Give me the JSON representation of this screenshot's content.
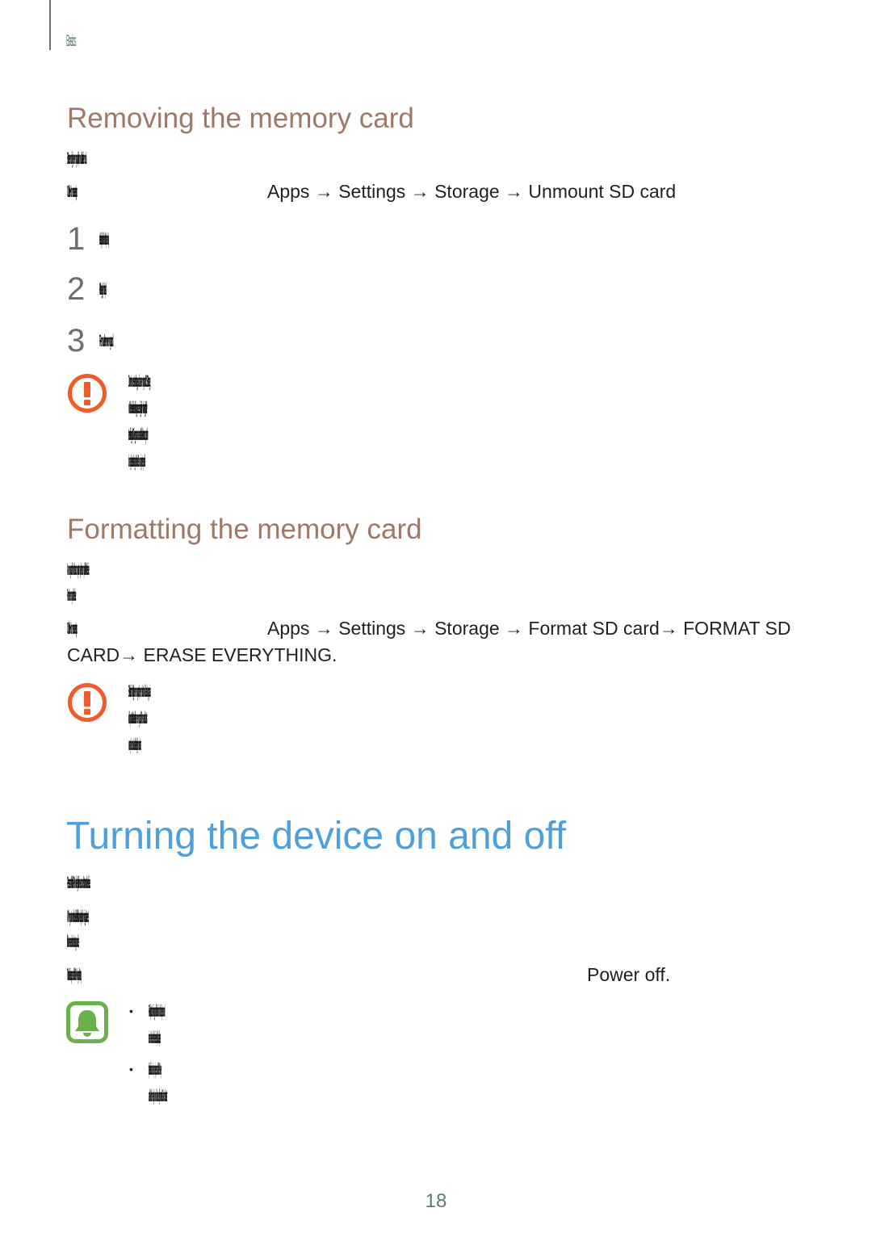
{
  "header": {
    "section_label": "Basics"
  },
  "removing": {
    "title": "Removing the memory card",
    "intro": "Before removing the memory card, first unmount it for safe removal.",
    "path_prefix": "On the Home screen, tap",
    "path": "Apps → Settings → Storage → Unmount SD card",
    "steps": [
      {
        "num": "1",
        "text": "Insert the ejection pin into the hole on the tray to loosen the tray."
      },
      {
        "num": "2",
        "text": "Pull out the tray gently from the tray slot."
      },
      {
        "num": "3",
        "text": "Remove the memory card."
      }
    ],
    "caution_lines": [
      "Do not remove external storage, such as a memory card or USB storage,",
      "while the device is transferring or accessing information, or right after",
      "transferring data. Doing so can cause data to be lost or corrupted or",
      "damage the external storage or the device. Samsung is not responsible"
    ]
  },
  "formatting": {
    "title": "Formatting the memory card",
    "intro_lines": [
      "A memory card formatted on a computer may not be compatible with the device.",
      "Format the memory card on the device."
    ],
    "path_prefix": "On the Home screen, tap",
    "path_line1": "Apps → Settings → Storage → Format SD card→ FORMAT SD",
    "path_line2": "CARD→ ERASE EVERYTHING.",
    "caution_lines": [
      "Before formatting the memory card, remember to make backup copies",
      "of all important data stored in the memory card. The manufacturer's",
      "warranty does not cover loss of data resulting from user actions."
    ]
  },
  "turning": {
    "title": "Turning the device on and off",
    "para1": "Press and hold the Power key for a few seconds to turn on the device.",
    "para2_lines": [
      "When you turn on the device for the first time or after performing a data reset,",
      "follow the on-screen instructions to set up your device."
    ],
    "para3_prefix": "To turn off the device, press and hold the Power key, and then tap",
    "para3_action": "Power off.",
    "notes": [
      {
        "bullet": "•",
        "lines": [
          "Follow all posted warnings and directions from authorized personnel",
          "in areas where the use of wireless devices is restricted, such as airplanes"
        ]
      },
      {
        "bullet": "•",
        "lines": [
          "If your device is frozen and unresponsive, press and hold the Power key",
          "and the Volume key down simultaneously for more than 7 seconds to restart"
        ]
      }
    ]
  },
  "icons": {
    "caution": "caution-icon",
    "note": "bell-note-icon"
  },
  "colors": {
    "subheading": "#a07868",
    "heading": "#4f9fdc",
    "caution": "#f15a29",
    "note": "#6ab04c"
  },
  "footer": {
    "page_number": "18"
  }
}
